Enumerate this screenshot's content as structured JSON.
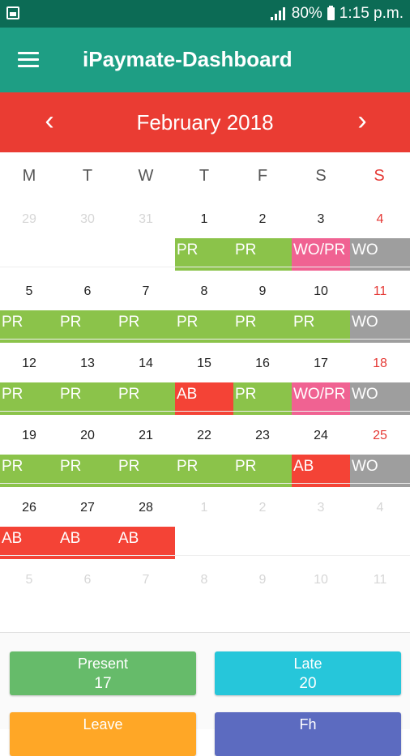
{
  "status_bar": {
    "battery": "80%",
    "time": "1:15 p.m."
  },
  "app_bar": {
    "title": "iPaymate-Dashboard"
  },
  "calendar": {
    "month_label": "February  2018",
    "prev_icon": "chevron-left-icon",
    "next_icon": "chevron-right-icon",
    "weekdays": [
      "M",
      "T",
      "W",
      "T",
      "F",
      "S",
      "S"
    ],
    "weeks": [
      {
        "days": [
          {
            "n": "29",
            "out": true
          },
          {
            "n": "30",
            "out": true
          },
          {
            "n": "31",
            "out": true
          },
          {
            "n": "1",
            "status": "PR"
          },
          {
            "n": "2",
            "status": "PR"
          },
          {
            "n": "3",
            "status": "WO/PR"
          },
          {
            "n": "4",
            "status": "WO"
          }
        ]
      },
      {
        "days": [
          {
            "n": "5",
            "status": "PR"
          },
          {
            "n": "6",
            "status": "PR"
          },
          {
            "n": "7",
            "status": "PR"
          },
          {
            "n": "8",
            "status": "PR"
          },
          {
            "n": "9",
            "status": "PR"
          },
          {
            "n": "10",
            "status": "PR"
          },
          {
            "n": "11",
            "status": "WO"
          }
        ]
      },
      {
        "days": [
          {
            "n": "12",
            "status": "PR"
          },
          {
            "n": "13",
            "status": "PR"
          },
          {
            "n": "14",
            "status": "PR"
          },
          {
            "n": "15",
            "status": "AB"
          },
          {
            "n": "16",
            "status": "PR"
          },
          {
            "n": "17",
            "status": "WO/PR"
          },
          {
            "n": "18",
            "status": "WO"
          }
        ]
      },
      {
        "days": [
          {
            "n": "19",
            "status": "PR"
          },
          {
            "n": "20",
            "status": "PR"
          },
          {
            "n": "21",
            "status": "PR"
          },
          {
            "n": "22",
            "status": "PR"
          },
          {
            "n": "23",
            "status": "PR"
          },
          {
            "n": "24",
            "status": "AB"
          },
          {
            "n": "25",
            "status": "WO"
          }
        ]
      },
      {
        "days": [
          {
            "n": "26",
            "status": "AB"
          },
          {
            "n": "27",
            "status": "AB"
          },
          {
            "n": "28",
            "status": "AB"
          },
          {
            "n": "1",
            "out": true
          },
          {
            "n": "2",
            "out": true
          },
          {
            "n": "3",
            "out": true
          },
          {
            "n": "4",
            "out": true
          }
        ]
      },
      {
        "days": [
          {
            "n": "5",
            "out": true
          },
          {
            "n": "6",
            "out": true
          },
          {
            "n": "7",
            "out": true
          },
          {
            "n": "8",
            "out": true
          },
          {
            "n": "9",
            "out": true
          },
          {
            "n": "10",
            "out": true
          },
          {
            "n": "11",
            "out": true
          }
        ]
      }
    ],
    "status_colors": {
      "PR": "#8bc34a",
      "WO/PR": "#f06292",
      "WO": "#9e9e9e",
      "AB": "#f44336"
    }
  },
  "summary": {
    "present": {
      "label": "Present",
      "value": "17",
      "color": "#66bb6a"
    },
    "late": {
      "label": "Late",
      "value": "20",
      "color": "#26c6da"
    },
    "leave": {
      "label": "Leave",
      "color": "#ffa726"
    },
    "fh": {
      "label": "Fh",
      "color": "#5c6bc0"
    }
  }
}
